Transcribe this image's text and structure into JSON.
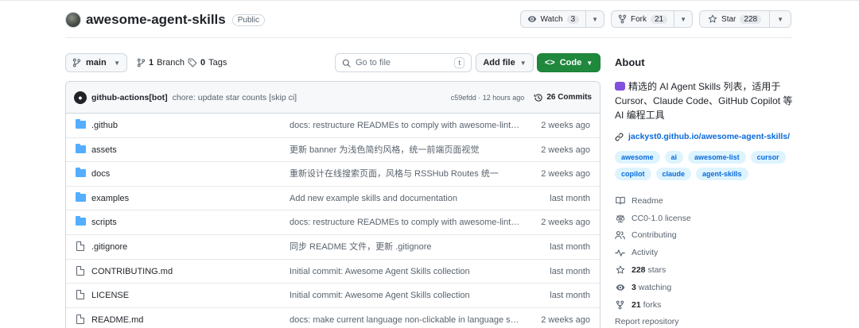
{
  "repo": {
    "name": "awesome-agent-skills",
    "visibility": "Public"
  },
  "actions": {
    "watch_label": "Watch",
    "watch_count": "3",
    "fork_label": "Fork",
    "fork_count": "21",
    "star_label": "Star",
    "star_count": "228"
  },
  "toolbar": {
    "branch": "main",
    "branches_count": "1",
    "branches_label": "Branch",
    "tags_count": "0",
    "tags_label": "Tags",
    "goto_placeholder": "Go to file",
    "goto_kbd": "t",
    "add_file": "Add file",
    "code": "Code"
  },
  "commit": {
    "author": "github-actions[bot]",
    "message": "chore: update star counts [skip ci]",
    "hash_time": "c59efdd · 12 hours ago",
    "count": "26 Commits"
  },
  "files": [
    {
      "type": "folder",
      "name": ".github",
      "message": "docs: restructure READMEs to comply with awesome-lint sta...",
      "time": "2 weeks ago"
    },
    {
      "type": "folder",
      "name": "assets",
      "message": "更新 banner 为浅色简约风格，统一前端页面视觉",
      "time": "2 weeks ago"
    },
    {
      "type": "folder",
      "name": "docs",
      "message": "重新设计在线搜索页面，风格与 RSSHub Routes 统一",
      "time": "2 weeks ago"
    },
    {
      "type": "folder",
      "name": "examples",
      "message": "Add new example skills and documentation",
      "time": "last month"
    },
    {
      "type": "folder",
      "name": "scripts",
      "message": "docs: restructure READMEs to comply with awesome-lint sta...",
      "time": "2 weeks ago"
    },
    {
      "type": "file",
      "name": ".gitignore",
      "message": "同步 README 文件，更新 .gitignore",
      "time": "last month"
    },
    {
      "type": "file",
      "name": "CONTRIBUTING.md",
      "message": "Initial commit: Awesome Agent Skills collection",
      "time": "last month"
    },
    {
      "type": "file",
      "name": "LICENSE",
      "message": "Initial commit: Awesome Agent Skills collection",
      "time": "last month"
    },
    {
      "type": "file",
      "name": "README.md",
      "message": "docs: make current language non-clickable in language swit...",
      "time": "2 weeks ago"
    }
  ],
  "about": {
    "title": "About",
    "description": "精选的 AI Agent Skills 列表，适用于 Cursor、Claude Code、GitHub Copilot 等 AI 编程工具",
    "link": "jackyst0.github.io/awesome-agent-skills/",
    "topics": [
      "awesome",
      "ai",
      "awesome-list",
      "cursor",
      "copilot",
      "claude",
      "agent-skills"
    ],
    "readme": "Readme",
    "license": "CC0-1.0 license",
    "contributing": "Contributing",
    "activity": "Activity",
    "stars": "228",
    "stars_label": "stars",
    "watching": "3",
    "watching_label": "watching",
    "forks": "21",
    "forks_label": "forks",
    "report": "Report repository"
  }
}
